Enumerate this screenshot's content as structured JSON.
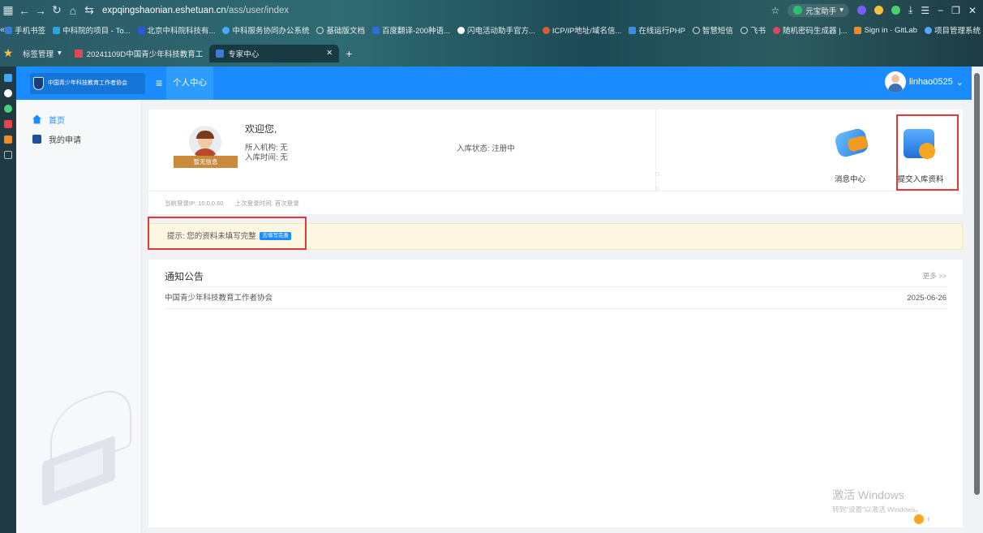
{
  "browser": {
    "url_host": "expqingshaonian.eshetuan.cn",
    "url_path": "/ass/user/index",
    "assistant_label": "元宝助手",
    "bookmarks": [
      "手机书签",
      "中科院的项目 - To...",
      "北京中科院科技有...",
      "中科服务协同办公系统",
      "基础版文档",
      "百度翻译-200种语...",
      "闪电活动助手官方...",
      "ICP/IP地址/域名信...",
      "在线运行PHP",
      "智慧短信",
      "飞书",
      "随机密码生成器 |...",
      "Sign in · GitLab",
      "项目管理系统"
    ],
    "tab_group": "标签管理",
    "tabs": [
      {
        "label": "20241109D中国青少年科技教育工"
      },
      {
        "label": "专家中心"
      }
    ]
  },
  "app": {
    "logo_text": "中国青少年科技教育工作者协会",
    "breadcrumb": "个人中心",
    "username": "linhao0525"
  },
  "sidebar": {
    "items": [
      {
        "label": "首页",
        "icon": "home-icon"
      },
      {
        "label": "我的申请",
        "icon": "application-icon"
      }
    ]
  },
  "profile": {
    "no_info": "暂无信息",
    "welcome": "欢迎您,",
    "institution": "所入机构:  无",
    "join_time": "入库时间:  无",
    "status": "入库状态:  注册中",
    "login_ip": "当前登录IP: 10.0.0.60",
    "last_login": "上次登录时间: 首次登录"
  },
  "actions": {
    "message_center": "消息中心",
    "submit_data": "提交入库资料"
  },
  "tip": {
    "text": "提示: 您的资料未填写完整",
    "button": "去填写完善"
  },
  "notices": {
    "title": "通知公告",
    "more": "更多 >>",
    "items": [
      {
        "title": "中国青少年科技教育工作者协会",
        "date": "2025-06-26"
      }
    ]
  },
  "watermark": {
    "line1": "激活 Windows",
    "line2": "转到\"设置\"以激活 Windows。"
  },
  "colors": {
    "primary": "#1a8cff",
    "highlight": "#e53935",
    "tip_bg": "#fdf6e1"
  }
}
